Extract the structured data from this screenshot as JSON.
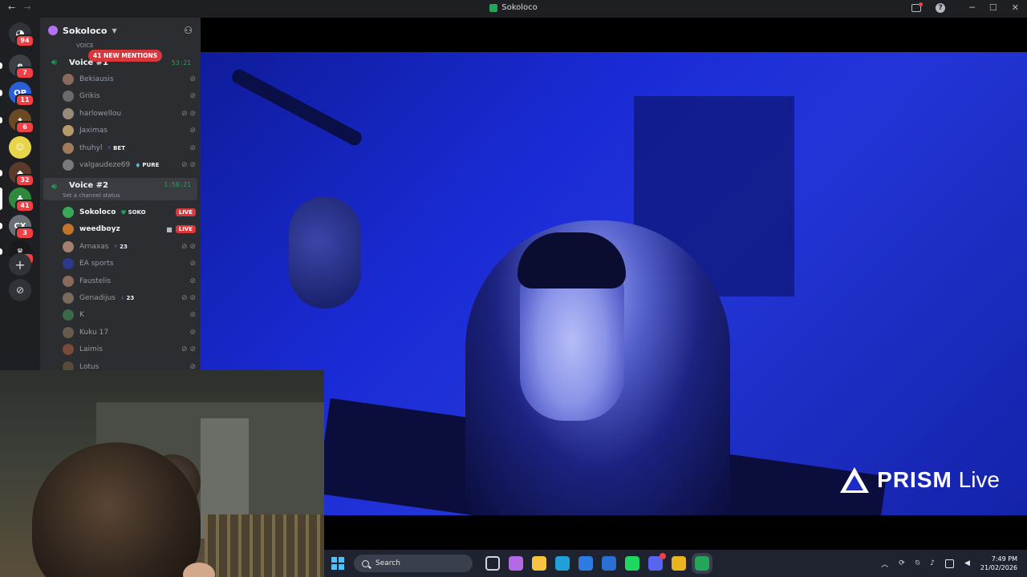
{
  "window": {
    "title": "Sokoloco",
    "nav_back": "←",
    "nav_forward": "→",
    "help": "?",
    "minimize": "─",
    "maximize": "☐",
    "close": "✕"
  },
  "rail": {
    "home_badge": "94",
    "servers": [
      {
        "name": "server-1",
        "color": "#3c3f46",
        "badge": "7",
        "glyph": "e"
      },
      {
        "name": "server-2",
        "color": "#2a5fd6",
        "badge": "11",
        "glyph": "QP"
      },
      {
        "name": "server-3",
        "color": "#6a4a24",
        "badge": "6",
        "glyph": "✦"
      },
      {
        "name": "server-4",
        "color": "#e8d44a",
        "badge": "",
        "glyph": "☺"
      },
      {
        "name": "server-5",
        "color": "#5a3a2a",
        "badge": "32",
        "glyph": "◆"
      },
      {
        "name": "server-6",
        "color": "#2e8a3a",
        "badge": "41",
        "glyph": "♣"
      },
      {
        "name": "server-7",
        "color": "#6b6f78",
        "badge": "3",
        "glyph": "CX"
      },
      {
        "name": "server-8",
        "color": "#1a1a1a",
        "badge": "3",
        "glyph": "♛"
      }
    ],
    "add_server": "+",
    "discover": "⊘"
  },
  "server": {
    "name": "Sokoloco",
    "mentions": "41 NEW MENTIONS",
    "voice_category": "VOICE"
  },
  "channels": [
    {
      "name": "Voice #1",
      "timer": "53:21"
    },
    {
      "name": "Voice #2",
      "timer": "1:58:21",
      "status": "Set a channel status"
    }
  ],
  "voice1_users": [
    {
      "name": "Bekiausis",
      "avatar": "#8a6a5a",
      "tag": "",
      "tag_type": ""
    },
    {
      "name": "Grikis",
      "avatar": "#6a6a6a",
      "tag": "",
      "tag_type": ""
    },
    {
      "name": "harlowellou",
      "avatar": "#9a8a7a",
      "tag": "",
      "tag_type": ""
    },
    {
      "name": "Jaximas",
      "avatar": "#b89a6a",
      "tag": "",
      "tag_type": ""
    },
    {
      "name": "thuhyl",
      "avatar": "#a07a5a",
      "tag": "BET",
      "tag_type": "bolt"
    },
    {
      "name": "valgaudeze69",
      "avatar": "#7a7a7a",
      "tag": "PURE",
      "tag_type": "drop"
    }
  ],
  "voice2_users": [
    {
      "name": "Sokoloco",
      "avatar": "#3aa856",
      "tag": "SOKO",
      "tag_type": "heart",
      "live": "LIVE"
    },
    {
      "name": "weedboyz",
      "avatar": "#c2742a",
      "tag": "",
      "tag_type": "",
      "live": "LIVE"
    },
    {
      "name": "Arnaxas",
      "avatar": "#a58070",
      "tag": "23",
      "tag_type": "bolt",
      "live": ""
    },
    {
      "name": "EA sports",
      "avatar": "#2c3a8a",
      "tag": "",
      "tag_type": "",
      "live": ""
    },
    {
      "name": "Faustelis",
      "avatar": "#8a6a5a",
      "tag": "",
      "tag_type": "",
      "live": ""
    },
    {
      "name": "Genadijus",
      "avatar": "#7a6a5a",
      "tag": "23",
      "tag_type": "bolt",
      "live": ""
    },
    {
      "name": "K",
      "avatar": "#3a6a4a",
      "tag": "",
      "tag_type": "",
      "live": ""
    },
    {
      "name": "Kuku 17",
      "avatar": "#6a5a4a",
      "tag": "",
      "tag_type": "",
      "live": ""
    },
    {
      "name": "Laimis",
      "avatar": "#7a4a3a",
      "tag": "",
      "tag_type": "",
      "live": ""
    },
    {
      "name": "Lotus",
      "avatar": "#5a4a3a",
      "tag": "",
      "tag_type": "",
      "live": ""
    }
  ],
  "stream": {
    "watermark_bold": "PRISM",
    "watermark_light": "Live"
  },
  "taskbar": {
    "search_placeholder": "Search",
    "time": "7:49 PM",
    "date": "21/02/2026",
    "apps": [
      {
        "name": "task-view-icon",
        "color": "#d0d4dc"
      },
      {
        "name": "copilot-icon",
        "color": "#b36ae2"
      },
      {
        "name": "file-explorer-icon",
        "color": "#f5c542"
      },
      {
        "name": "edge-icon",
        "color": "#1fa0d8"
      },
      {
        "name": "store-icon",
        "color": "#2d7ae0"
      },
      {
        "name": "mail-icon",
        "color": "#2a6fd4"
      },
      {
        "name": "spotify-icon",
        "color": "#1ed760"
      },
      {
        "name": "discord-icon",
        "color": "#5865f2"
      },
      {
        "name": "chrome-icon",
        "color": "#e8b520"
      },
      {
        "name": "sokoloco-app-icon",
        "color": "#23a55a"
      }
    ]
  }
}
